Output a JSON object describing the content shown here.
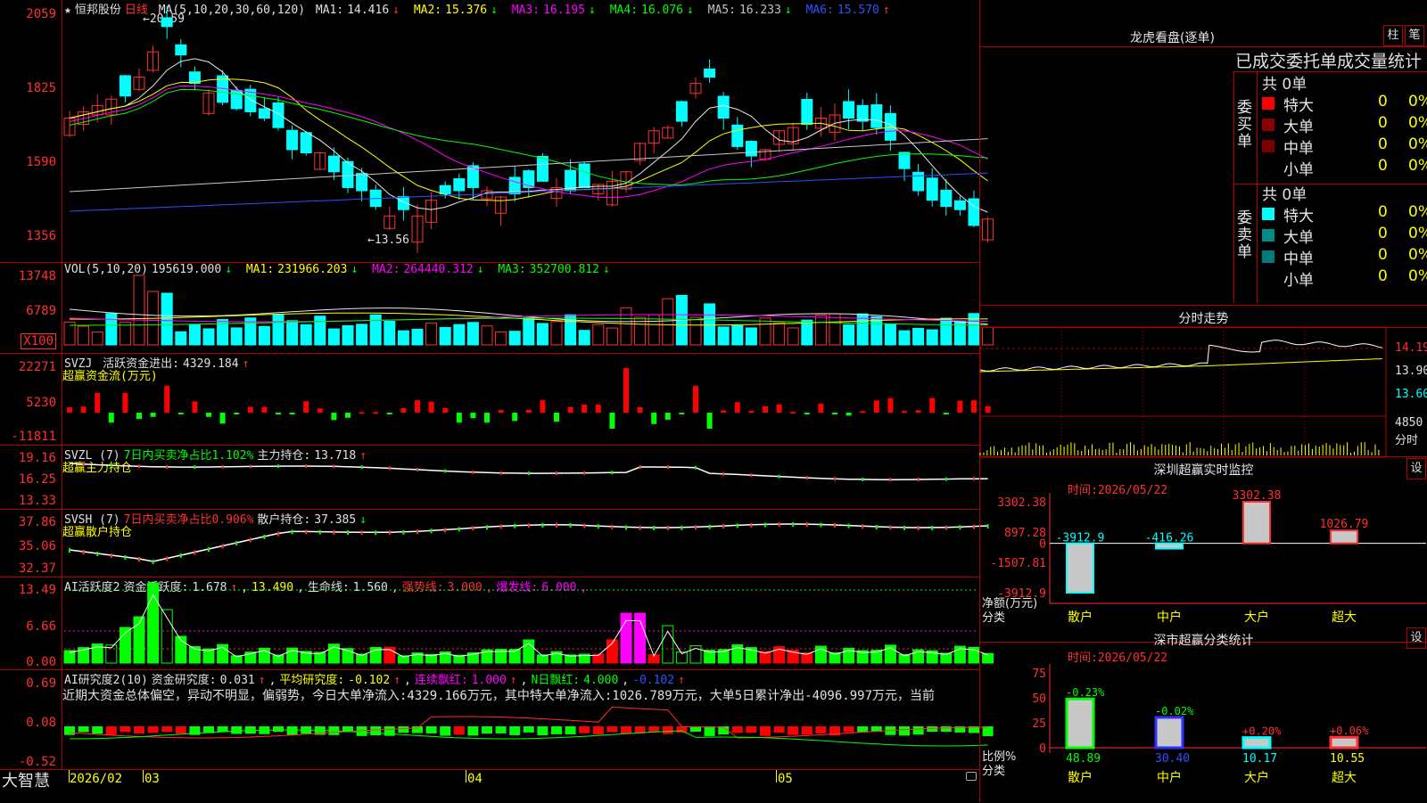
{
  "stock": {
    "star": "★",
    "name": "恒邦股份",
    "period": "日线"
  },
  "kline": {
    "ma_label": "MA(5,10,20,30,60,120)",
    "ma": [
      {
        "name": "MA1:",
        "value": "14.416",
        "arrow": "↓",
        "color": "#e0e0e0"
      },
      {
        "name": "MA2:",
        "value": "15.376",
        "arrow": "↓",
        "color": "#ffff00"
      },
      {
        "name": "MA3:",
        "value": "16.195",
        "arrow": "↓",
        "color": "#ff00ff"
      },
      {
        "name": "MA4:",
        "value": "16.076",
        "arrow": "↓",
        "color": "#00ff00"
      },
      {
        "name": "MA5:",
        "value": "16.233",
        "arrow": "↓",
        "color": "#c0c0c0"
      },
      {
        "name": "MA6:",
        "value": "15.570",
        "arrow": "↑",
        "color": "#3050ff"
      }
    ],
    "yticks": [
      "2059",
      "1825",
      "1590",
      "1356"
    ],
    "high_note": "←20.59",
    "low_note": "←13.56"
  },
  "vol": {
    "label": "VOL(5,10,20)",
    "value": "195619.000",
    "arrow": "↓",
    "ma": [
      {
        "name": "MA1:",
        "value": "231966.203",
        "arrow": "↓",
        "color": "#ffff00"
      },
      {
        "name": "MA2:",
        "value": "264440.312",
        "arrow": "↓",
        "color": "#ff00ff"
      },
      {
        "name": "MA3:",
        "value": "352700.812",
        "arrow": "↓",
        "color": "#00ff00"
      }
    ],
    "yticks": [
      "13748",
      "6789"
    ],
    "unit": "X100"
  },
  "svzj": {
    "label": "SVZJ",
    "title": "活跃资金进出:",
    "value": "4329.184",
    "arrow": "↑",
    "sub": "超赢资金流(万元)",
    "yticks": [
      "22271",
      "5230",
      "-11811"
    ]
  },
  "svzl": {
    "label": "SVZL (7)",
    "t1": "7日内买卖净占比1.102%",
    "t2": "主力持仓:",
    "value": "13.718",
    "arrow": "↑",
    "sub": "超赢主力持仓",
    "yticks": [
      "19.16",
      "16.25",
      "13.33"
    ]
  },
  "svsh": {
    "label": "SVSH (7)",
    "t1": "7日内买卖净占比0.906%",
    "t2": "散户持仓:",
    "value": "37.385",
    "arrow": "↓",
    "sub": "超赢散户持仓",
    "yticks": [
      "37.86",
      "35.06",
      "32.37"
    ]
  },
  "ai1": {
    "label": "AI活跃度2",
    "t1": "资金活跃度:",
    "v1": "1.678",
    "a1": "↑",
    "v2": "13.490",
    "t3": "生命线:",
    "v3": "1.560",
    "t4": "强势线:",
    "v4": "3.000",
    "t5": "爆发线:",
    "v5": "6.000",
    "yticks": [
      "13.49",
      "6.66",
      "0.00"
    ]
  },
  "ai2": {
    "label": "AI研究度2(10)",
    "t1": "资金研究度:",
    "v1": "0.031",
    "a1": "↑",
    "t2": "平均研究度:",
    "v2": "-0.102",
    "a2": "↑",
    "t3": "连续飘红:",
    "v3": "1.000",
    "a3": "↑",
    "t4": "N日飘红:",
    "v4": "4.000",
    "v5": "-0.102",
    "a5": "↑",
    "comment": "近期大资金总体偏空，异动不明显，偏弱势，今日大单净流入:4329.166万元，其中特大单净流入:1026.789万元，大单5日累计净出-4096.997万元，当前",
    "yticks": [
      "0.69",
      "0.08",
      "-0.52"
    ]
  },
  "xaxis": {
    "brand": "大智慧",
    "labels": [
      "2026/02",
      "03",
      "04",
      "05"
    ]
  },
  "lhb": {
    "title": "龙虎看盘(逐单)",
    "btn1": "柱",
    "btn2": "笔",
    "subtitle": "已成交委托单成交量统计",
    "buy": {
      "side": "委买单",
      "total": "共 0单",
      "rows": [
        {
          "label": "特大",
          "count": "0",
          "pct": "0%",
          "color": "#ff0000"
        },
        {
          "label": "大单",
          "count": "0",
          "pct": "0%",
          "color": "#8b0000"
        },
        {
          "label": "中单",
          "count": "0",
          "pct": "0%",
          "color": "#7a0000"
        },
        {
          "label": "小单",
          "count": "0",
          "pct": "0%",
          "color": ""
        }
      ]
    },
    "sell": {
      "side": "委卖单",
      "total": "共 0单",
      "rows": [
        {
          "label": "特大",
          "count": "0",
          "pct": "0%",
          "color": "#00ffff"
        },
        {
          "label": "大单",
          "count": "0",
          "pct": "0%",
          "color": "#008b8b"
        },
        {
          "label": "中单",
          "count": "0",
          "pct": "0%",
          "color": "#007a7a"
        },
        {
          "label": "小单",
          "count": "0",
          "pct": "0%",
          "color": ""
        }
      ]
    }
  },
  "intraday": {
    "title": "分时走势",
    "yticks": [
      "14.19",
      "13.90",
      "13.60"
    ],
    "vol_tick": "4850",
    "vol_label": "分时"
  },
  "monitor": {
    "title": "深圳超赢实时监控",
    "btn": "设",
    "time_label": "时间:",
    "time": "2026/05/22",
    "yticks": [
      "3302.38",
      "897.28",
      "0",
      "-1507.81",
      "-3912.9"
    ],
    "ylabel": "净额(万元)",
    "xlabel": "分类",
    "cats": [
      "散户",
      "中户",
      "大户",
      "超大"
    ],
    "values": [
      -3912.9,
      -416.26,
      3302.38,
      1026.79
    ],
    "vlabels": [
      "-3912.9",
      "-416.26",
      "3302.38",
      "1026.79"
    ]
  },
  "classify": {
    "title": "深市超赢分类统计",
    "btn": "设",
    "time_label": "时间:",
    "time": "2026/05/22",
    "yticks": [
      "75",
      "50",
      "25",
      "0"
    ],
    "ylabel": "比例%",
    "xlabel": "分类",
    "cats": [
      "散户",
      "中户",
      "大户",
      "超大"
    ],
    "values": [
      48.89,
      30.4,
      10.17,
      10.55
    ],
    "vlabels": [
      "48.89",
      "30.40",
      "10.17",
      "10.55"
    ],
    "deltas": [
      "-0.23%",
      "-0.02%",
      "+0.20%",
      "+0.06%"
    ]
  }
}
